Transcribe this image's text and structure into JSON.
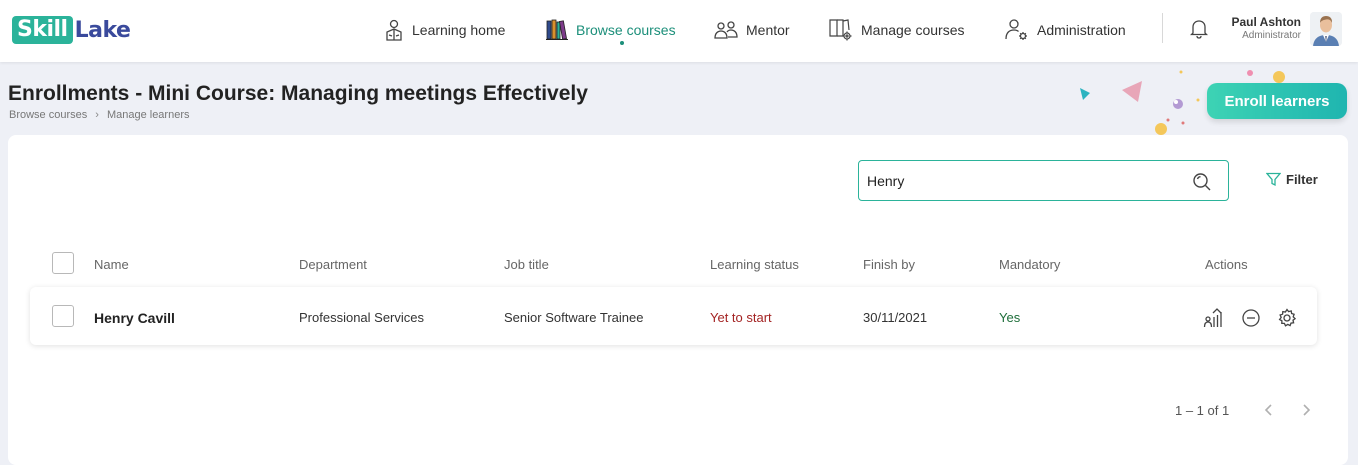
{
  "app": {
    "logo_left": "Skill",
    "logo_right": "Lake"
  },
  "nav": {
    "items": [
      {
        "label": "Learning home",
        "icon": "learning-home-icon"
      },
      {
        "label": "Browse courses",
        "icon": "books-icon",
        "active": true
      },
      {
        "label": "Mentor",
        "icon": "mentor-icon"
      },
      {
        "label": "Manage courses",
        "icon": "manage-courses-icon"
      },
      {
        "label": "Administration",
        "icon": "administration-icon"
      }
    ],
    "active_color": "#1c8f7a"
  },
  "user": {
    "name": "Paul Ashton",
    "role": "Administrator"
  },
  "page": {
    "title": "Enrollments - Mini Course: Managing meetings Effectively",
    "breadcrumb": [
      "Browse courses",
      "Manage learners"
    ],
    "enroll_button": "Enroll learners"
  },
  "search": {
    "value": "Henry",
    "filter_label": "Filter"
  },
  "table": {
    "headers": [
      "Name",
      "Department",
      "Job title",
      "Learning status",
      "Finish by",
      "Mandatory",
      "Actions"
    ],
    "rows": [
      {
        "name": "Henry Cavill",
        "department": "Professional Services",
        "job_title": "Senior Software Trainee",
        "learning_status": "Yet to start",
        "finish_by": "30/11/2021",
        "mandatory": "Yes",
        "actions": [
          "progress-icon",
          "remove-icon",
          "settings-icon"
        ]
      }
    ]
  },
  "pagination": {
    "summary": "1 – 1 of 1"
  },
  "colors": {
    "accent": "#2bb39a",
    "status_yet_to_start": "#a42424",
    "mandatory_yes": "#1e6e3a"
  }
}
